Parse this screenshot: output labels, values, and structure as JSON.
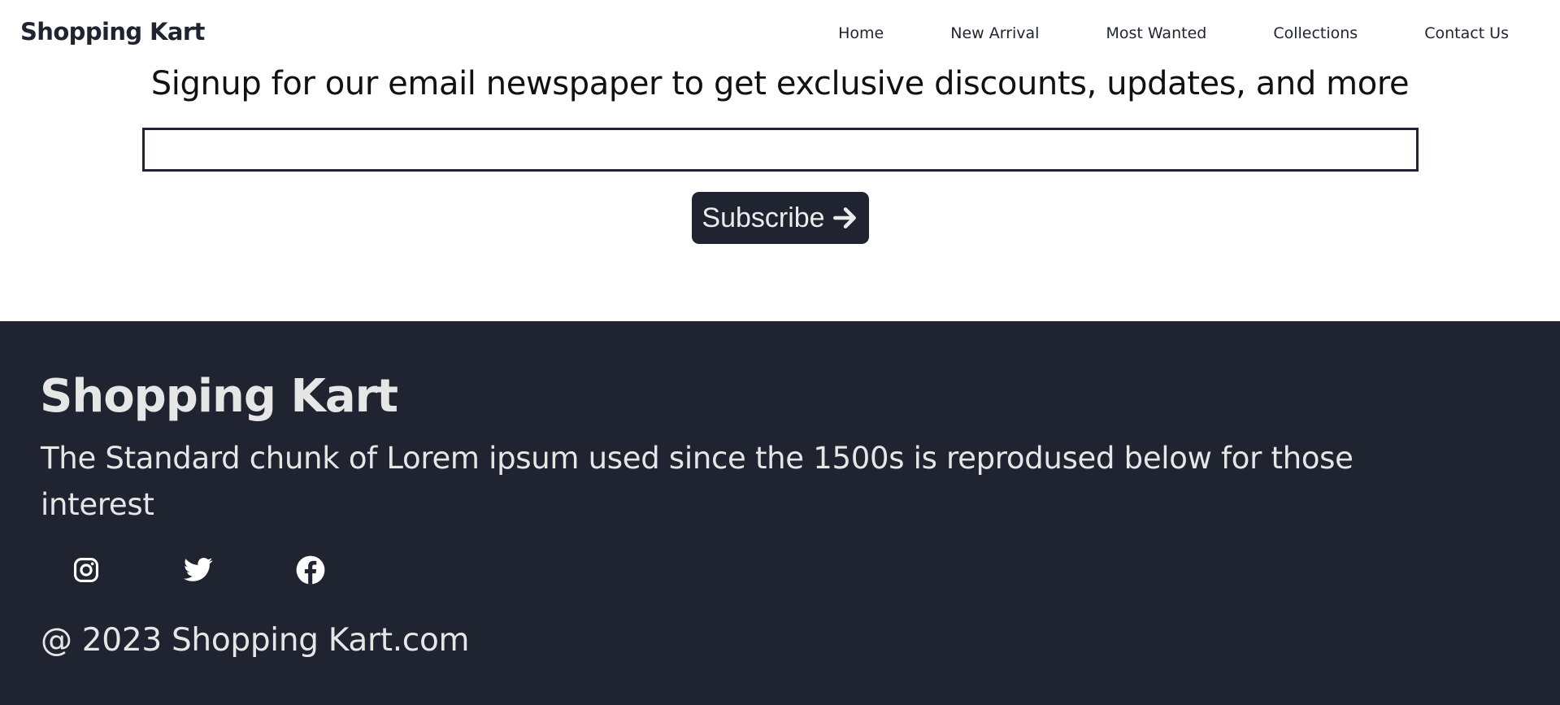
{
  "header": {
    "brand": "Shopping Kart",
    "nav": [
      {
        "label": "Home",
        "icon": null
      },
      {
        "label": "New Arrival",
        "icon": null
      },
      {
        "label": "Most Wanted",
        "icon": null
      },
      {
        "label": "Collections",
        "icon": null
      },
      {
        "label": "Contact Us",
        "icon": null
      }
    ]
  },
  "newsletter": {
    "title": "Signup for our email newspaper to get exclusive discounts, updates, and more",
    "email_value": "",
    "email_placeholder": "",
    "subscribe_label": "Subscribe",
    "subscribe_icon": "arrow-right-icon"
  },
  "footer": {
    "brand": "Shopping Kart",
    "description": "The Standard chunk of Lorem ipsum used since the 1500s is reprodused below for those interest",
    "social": [
      {
        "name": "instagram-icon"
      },
      {
        "name": "twitter-icon"
      },
      {
        "name": "facebook-icon"
      }
    ],
    "copyright": "@ 2023 Shopping Kart.com"
  },
  "colors": {
    "dark": "#1f2430",
    "light_text": "#e6e6e6",
    "background": "#ffffff"
  }
}
